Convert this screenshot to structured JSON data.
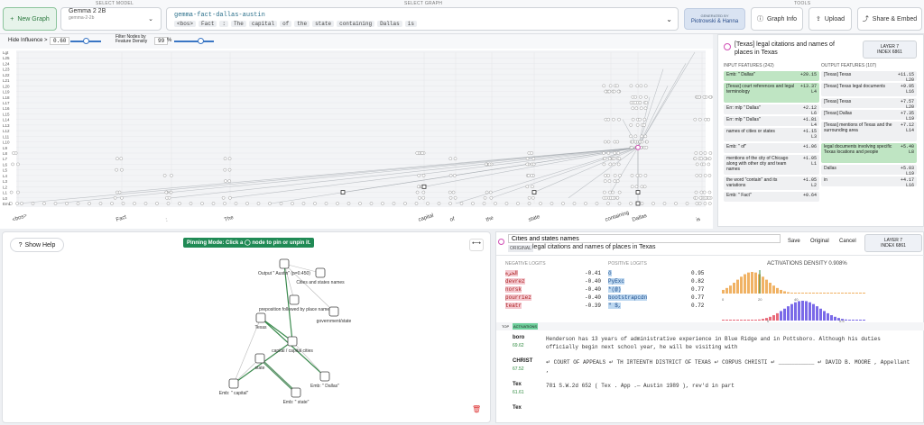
{
  "top": {
    "caption_model": "SELECT MODEL",
    "caption_graph": "SELECT GRAPH",
    "caption_tools": "TOOLS",
    "new_graph": "New Graph",
    "model_name": "Gemma 2 2B",
    "model_sub": "gemma-2-2b",
    "graph_name": "gemma-fact-dallas-austin",
    "prompt_tokens": [
      "<bos>",
      "Fact",
      ":",
      "The",
      "capital",
      "of",
      "the",
      "state",
      "containing",
      "Dallas",
      "is"
    ],
    "generated_by": "GENERATED BY",
    "generated_authors": "Piotrowski & Hanna",
    "graph_info": "Graph Info",
    "upload": "Upload",
    "share": "Share & Embed"
  },
  "controls": {
    "hide_influence_label": "Hide Influence >",
    "hide_influence_value": "0.60",
    "filter_label": "Filter Nodes by Feature Density",
    "filter_value": "99",
    "filter_unit": "%"
  },
  "plot": {
    "layers": [
      "Lgt",
      "L25",
      "L24",
      "L23",
      "L22",
      "L21",
      "L20",
      "L19",
      "L18",
      "L17",
      "L16",
      "L15",
      "L14",
      "L13",
      "L12",
      "L11",
      "L10",
      "L9",
      "L8",
      "L7",
      "L6",
      "L5",
      "L4",
      "L3",
      "L2",
      "L1",
      "L0",
      "Emb"
    ],
    "tokens": [
      "<bos>",
      "Fact",
      ":",
      "The",
      "capital",
      "of",
      "the",
      "state",
      "containing",
      "Dallas",
      "is"
    ]
  },
  "feature": {
    "title": "[Texas] legal citations and names of places in Texas",
    "layer": "LAYER 7",
    "index": "INDEX 6861",
    "input_header": "INPUT FEATURES (242)",
    "output_header": "OUTPUT FEATURES (107)",
    "inputs": [
      {
        "name": "Emb: \" Dallas\"",
        "val": "+20.15",
        "layer": "",
        "hl": true
      },
      {
        "name": "[Texas] court references and legal terminology",
        "val": "+13.37",
        "layer": "L4",
        "hl": true
      },
      {
        "name": "Err: mlp \" Dallas\"",
        "val": "+2.12",
        "layer": "L6",
        "hl": false
      },
      {
        "name": "Err: mlp \" Dallas\"",
        "val": "+1.81",
        "layer": "L4",
        "hl": false
      },
      {
        "name": "names of cities or states",
        "val": "+1.15",
        "layer": "L3",
        "hl": false
      },
      {
        "name": "Emb: \" of\"",
        "val": "+1.06",
        "layer": "",
        "hl": false
      },
      {
        "name": "mentions of the city of Chicago along with other city and team names",
        "val": "+1.05",
        "layer": "L1",
        "hl": false
      },
      {
        "name": "the word \"contain\" and its variations",
        "val": "+1.05",
        "layer": "L2",
        "hl": false
      },
      {
        "name": "Emb: \" Fact\"",
        "val": "+0.64",
        "layer": "",
        "hl": false
      }
    ],
    "outputs": [
      {
        "name": "[Texas] Texas",
        "val": "+11.15",
        "layer": "L20",
        "hl": false
      },
      {
        "name": "[Texas] Texas legal documents",
        "val": "+9.95",
        "layer": "L16",
        "hl": false
      },
      {
        "name": "[Texas] Texas",
        "val": "+7.57",
        "layer": "L20",
        "hl": false
      },
      {
        "name": "[Texas] Dallas",
        "val": "+7.35",
        "layer": "L19",
        "hl": false
      },
      {
        "name": "[Texas] mentions of Texas and the surrounding area",
        "val": "+7.12",
        "layer": "L14",
        "hl": false
      },
      {
        "name": "legal documents involving specific Texas locations and people",
        "val": "+5.40",
        "layer": "L8",
        "hl": true
      },
      {
        "name": "Dallas",
        "val": "+5.03",
        "layer": "L19",
        "hl": false
      },
      {
        "name": "in",
        "val": "+4.17",
        "layer": "L16",
        "hl": false
      }
    ]
  },
  "subgraph": {
    "show_help": "Show Help",
    "pin_mode": "Pinning Mode: Click a ◯ node to pin or unpin it.",
    "nodes": {
      "output": "Output \" Austin\" (p=0.450)",
      "cities": "Cities and states names",
      "prep": "preposition followed by place name",
      "govt": "government/state",
      "texas": "Texas",
      "capital": "capital / capital cities",
      "state": "state",
      "emb_capital": "Emb: \" capital\"",
      "emb_state": "Emb: \" state\"",
      "emb_dallas": "Emb: \" Dallas\""
    }
  },
  "detail": {
    "label_input": "Cities and states names",
    "tag_original": "ORIGINAL",
    "original_name": "legal citations and names of places in Texas",
    "save": "Save",
    "original": "Original",
    "cancel": "Cancel",
    "layer": "LAYER 7",
    "index": "INDEX 6861",
    "neg_header": "NEGATIVE LOGITS",
    "pos_header": "POSITIVE LOGITS",
    "density_header": "ACTIVATIONS DENSITY 0.908%",
    "neg_logits": [
      {
        "t": "الحرة",
        "v": "-0.41"
      },
      {
        "t": "devrez",
        "v": "-0.40"
      },
      {
        "t": "norsk",
        "v": "-0.40"
      },
      {
        "t": "pourriez",
        "v": "-0.40"
      },
      {
        "t": "teatr",
        "v": "-0.39"
      }
    ],
    "pos_logits": [
      {
        "t": "ö",
        "v": "0.95"
      },
      {
        "t": "PyExc",
        "v": "0.82"
      },
      {
        "t": "*(@)",
        "v": "0.77"
      },
      {
        "t": "bootstrapcdn",
        "v": "0.77"
      },
      {
        "t": "\" $,",
        "v": "0.72"
      }
    ],
    "hist_top_ticks": [
      "0",
      "20",
      "40"
    ],
    "hist_bot_ticks": [
      "0",
      "0.5"
    ],
    "top_tab": "TOP",
    "act_tab": "ACTIVATIONS",
    "examples": [
      {
        "tok": "boro",
        "score": "69.62",
        "text": "Henderson has 13 years of administrative experience in Blue Ridge and in Pottsboro. Although his duties officially begin next school year, he will be visiting with"
      },
      {
        "tok": "CHRIST",
        "score": "67.52",
        "text": "↵ COURT OF APPEALS ↵ TH IRTEENTH DISTRICT OF TEXAS ↵ CORPUS CHRISTI ↵ ___________ ↵ DAVID B. MOORE , Appellant ,"
      },
      {
        "tok": "Tex",
        "score": "61.61",
        "text": "781 S.W.2d 652 ( Tex . App .— Austin 1989 ), rev'd in part"
      },
      {
        "tok": "Tex",
        "score": "",
        "text": ""
      }
    ]
  }
}
